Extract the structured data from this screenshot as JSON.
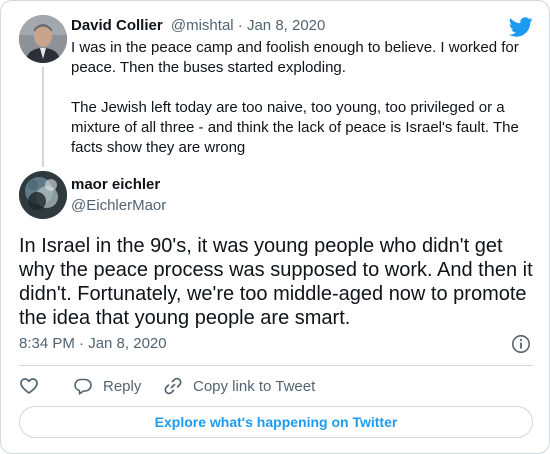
{
  "colors": {
    "brand_blue": "#1d9bf0",
    "text_primary": "#0f1419",
    "text_secondary": "#536471",
    "border": "#cfd9de"
  },
  "parent_tweet": {
    "author_name": "David Collier",
    "author_handle": "@mishtal",
    "separator": " · ",
    "date": "Jan 8, 2020",
    "paragraphs": [
      "I was in the peace camp and foolish enough to believe. I worked for peace. Then the buses started exploding.",
      "The Jewish left today are too naive, too young, too privileged or a mixture of all three - and think the lack of peace is Israel's fault. The facts show they are wrong"
    ]
  },
  "tweet": {
    "author_name": "maor eichler",
    "author_handle": "@EichlerMaor",
    "text": "In Israel in the 90's, it was young people who didn't get why the peace process was supposed to work. And then it didn't. Fortunately, we're too middle-aged now to promote the idea that young people are smart.",
    "timestamp": "8:34 PM · Jan 8, 2020"
  },
  "actions": {
    "like_icon": "heart-icon",
    "reply_label": "Reply",
    "reply_icon": "speech-bubble-icon",
    "copy_link_label": "Copy link to Tweet",
    "copy_link_icon": "link-icon"
  },
  "explore_label": "Explore what's happening on Twitter",
  "icons": {
    "logo": "twitter-bird-icon",
    "info": "info-icon"
  }
}
